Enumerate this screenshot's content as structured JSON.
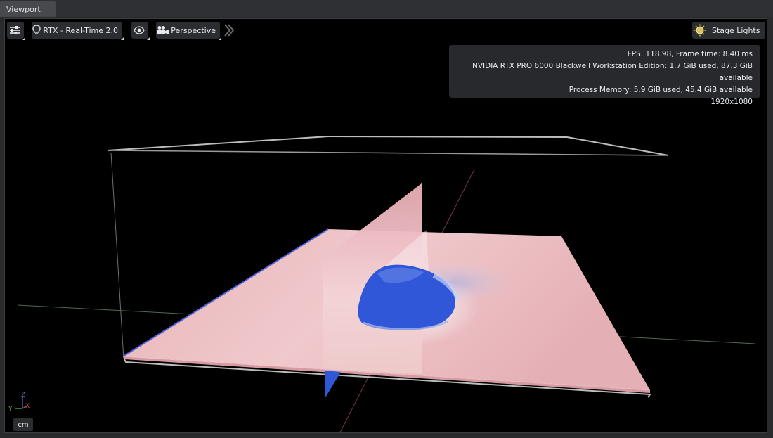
{
  "tab": {
    "title": "Viewport"
  },
  "toolbar": {
    "settings_icon": "sliders-icon",
    "renderer_label": "RTX - Real-Time 2.0",
    "renderer_icon": "lightbulb-icon",
    "visibility_icon": "eye-icon",
    "camera_label": "Perspective",
    "camera_icon": "camera-icon",
    "expand_icon": "chevron-right-icon",
    "lights_label": "Stage Lights",
    "lights_icon": "sun-icon"
  },
  "stats": {
    "fps": "FPS: 118.98, Frame time: 8.40 ms",
    "gpu": "NVIDIA RTX PRO 6000 Blackwell Workstation Edition: 1.7 GiB used, 87.3 GiB available",
    "memory": "Process Memory: 5.9 GiB used, 45.4 GiB available",
    "resolution": "1920x1080"
  },
  "axes": {
    "z": "Z",
    "y": "Y",
    "x": "X"
  },
  "units": {
    "label": "cm"
  },
  "colors": {
    "accent_blue": "#2f57d8",
    "plane_pink": "#e6b2b7"
  }
}
